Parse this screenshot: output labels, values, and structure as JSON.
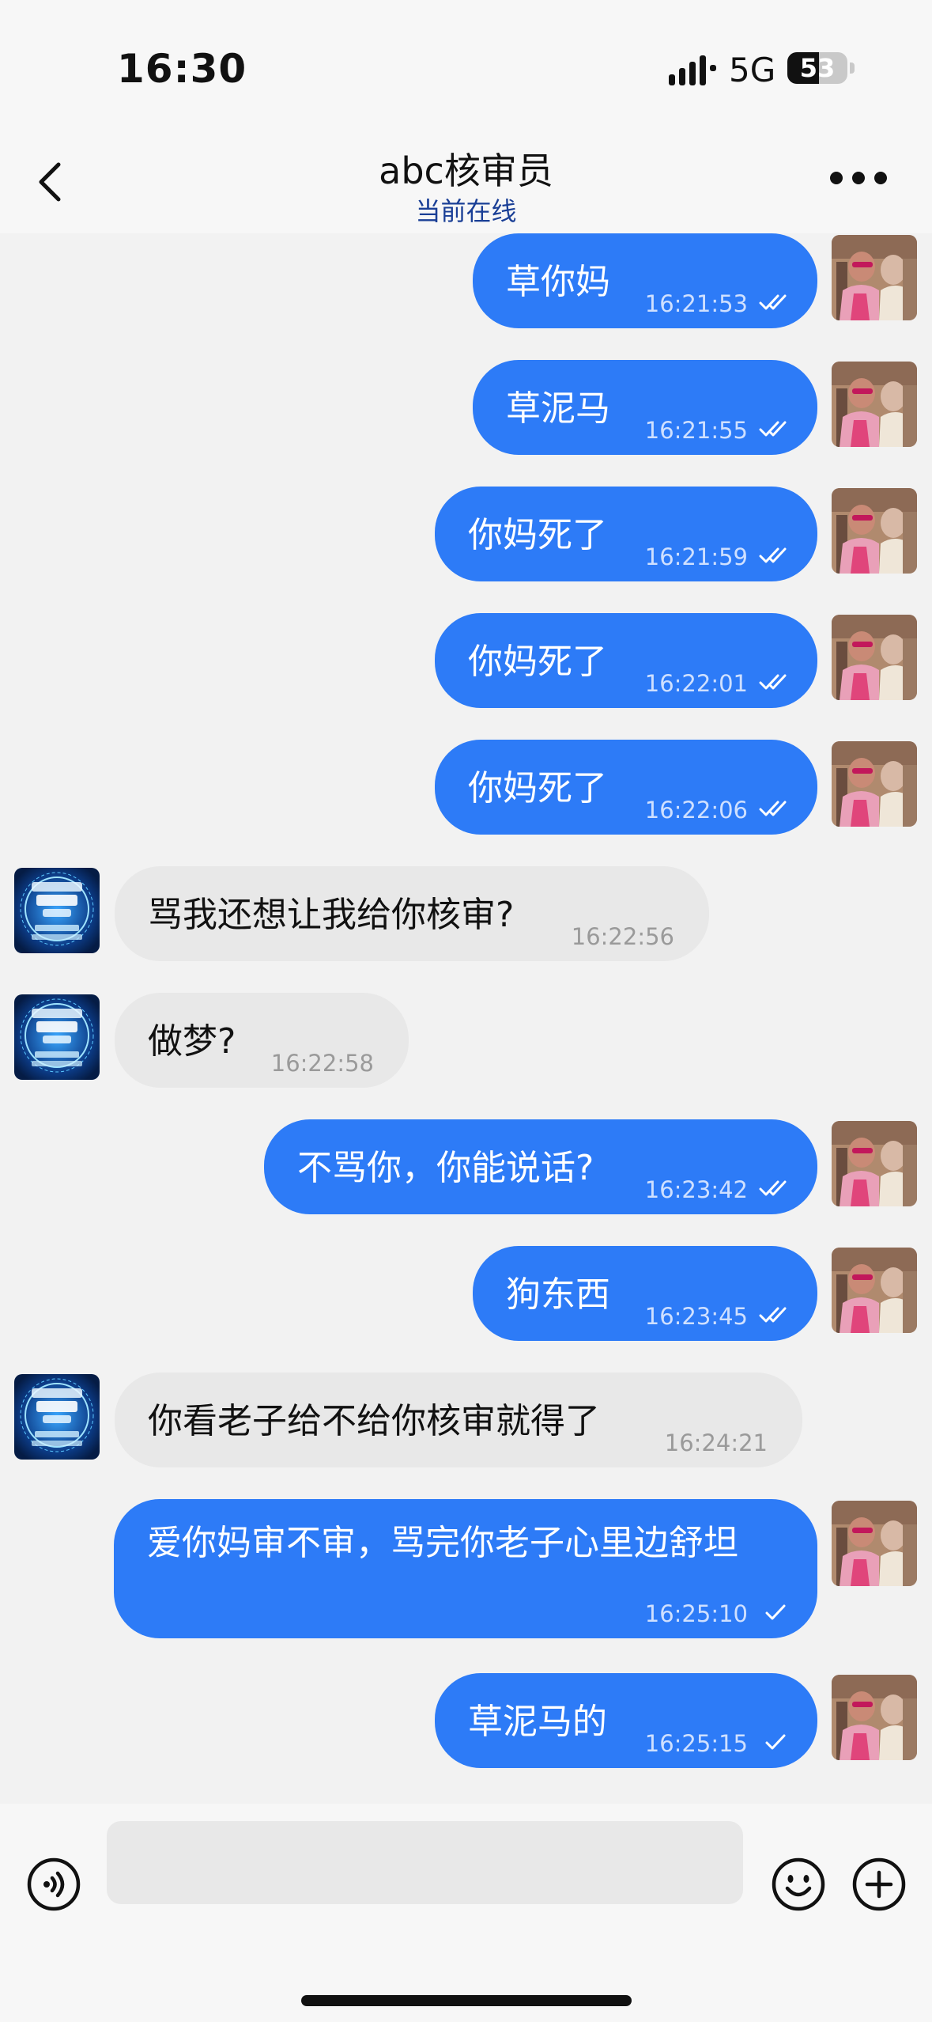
{
  "status_bar": {
    "time": "16:30",
    "network": "5G",
    "battery": "53",
    "battery_level": 0.53
  },
  "header": {
    "title": "abc核审员",
    "subtitle": "当前在线"
  },
  "colors": {
    "sent_bubble": "#2d7bf7",
    "received_bubble": "#e8e8e8",
    "subtitle": "#1a3f96",
    "background": "#f2f2f2"
  },
  "messages": [
    {
      "sender": "me",
      "text": "草你妈",
      "time": "16:21:53",
      "status": "read"
    },
    {
      "sender": "me",
      "text": "草泥马",
      "time": "16:21:55",
      "status": "read"
    },
    {
      "sender": "me",
      "text": "你妈死了",
      "time": "16:21:59",
      "status": "read"
    },
    {
      "sender": "me",
      "text": "你妈死了",
      "time": "16:22:01",
      "status": "read"
    },
    {
      "sender": "me",
      "text": "你妈死了",
      "time": "16:22:06",
      "status": "read"
    },
    {
      "sender": "them",
      "text": "骂我还想让我给你核审?",
      "time": "16:22:56"
    },
    {
      "sender": "them",
      "text": "做梦?",
      "time": "16:22:58"
    },
    {
      "sender": "me",
      "text": "不骂你，你能说话?",
      "time": "16:23:42",
      "status": "read"
    },
    {
      "sender": "me",
      "text": "狗东西",
      "time": "16:23:45",
      "status": "read"
    },
    {
      "sender": "them",
      "text": "你看老子给不给你核审就得了",
      "time": "16:24:21"
    },
    {
      "sender": "me",
      "text": "爱你妈审不审，骂完你老子心里边舒坦",
      "time": "16:25:10",
      "status": "sent"
    },
    {
      "sender": "me",
      "text": "草泥马的",
      "time": "16:25:15",
      "status": "sent"
    }
  ],
  "input": {
    "value": "",
    "placeholder": ""
  },
  "icons": {
    "back": "chevron-left-icon",
    "more": "more-dots-icon",
    "voice": "voice-icon",
    "emoji": "emoji-icon",
    "plus": "plus-icon",
    "read": "double-check-icon",
    "sent": "check-icon"
  }
}
